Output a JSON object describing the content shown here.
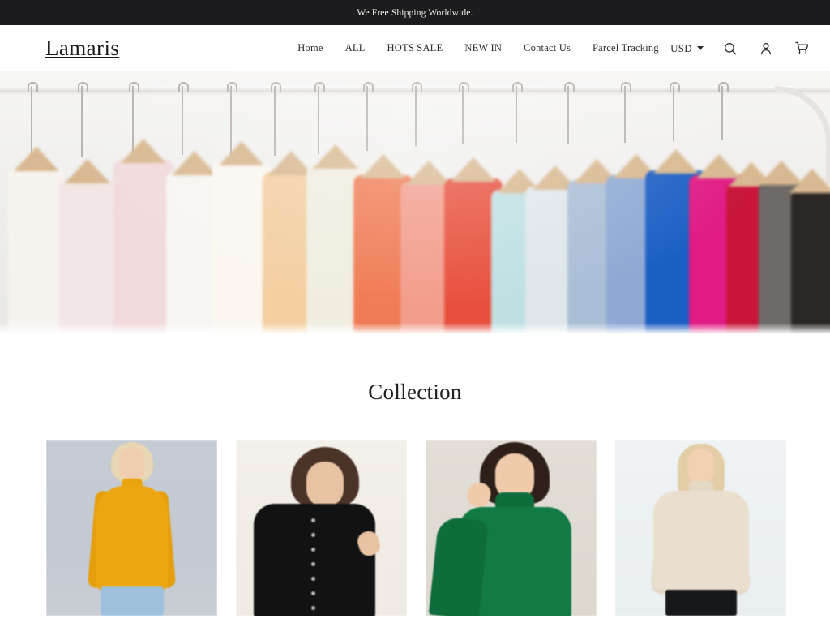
{
  "announcement": {
    "text": "We Free Shipping Worldwide.",
    "background_color": "#1c1c1e",
    "text_color": "#f2f2f2"
  },
  "header": {
    "logo": "Lamaris",
    "nav": [
      {
        "label": "Home",
        "name": "nav-home"
      },
      {
        "label": "ALL",
        "name": "nav-all"
      },
      {
        "label": "HOTS SALE",
        "name": "nav-hots-sale"
      },
      {
        "label": "NEW IN",
        "name": "nav-new-in"
      },
      {
        "label": "Contact Us",
        "name": "nav-contact-us"
      },
      {
        "label": "Parcel Tracking",
        "name": "nav-parcel-tracking"
      }
    ],
    "currency": {
      "selected": "USD",
      "icon": "chevron-down-icon"
    },
    "icons": [
      {
        "name": "search-icon",
        "label": "Search"
      },
      {
        "name": "account-icon",
        "label": "Account"
      },
      {
        "name": "cart-icon",
        "label": "Cart"
      }
    ]
  },
  "hero": {
    "alt": "Clothing rack with colorful garments on wooden hangers",
    "name": "hero-banner"
  },
  "collection": {
    "title": "Collection",
    "products": [
      {
        "name": "product-card-yellow-turtleneck",
        "alt": "Model wearing mustard yellow turtleneck sweater with blue jeans",
        "background_color": "#c5cbd3",
        "garment_color": "#eda60f"
      },
      {
        "name": "product-card-black-cardigan",
        "alt": "Model wearing black buttoned cardigan sweater",
        "background_color": "#f3efe9",
        "garment_color": "#121212"
      },
      {
        "name": "product-card-green-sweater",
        "alt": "Model wearing green mock neck sweater",
        "background_color": "#e2ded7",
        "garment_color": "#127a45"
      },
      {
        "name": "product-card-cream-turtleneck",
        "alt": "Model wearing cream turtleneck sweater with black pants",
        "background_color": "#eef2f3",
        "garment_color": "#eadfce"
      }
    ]
  }
}
